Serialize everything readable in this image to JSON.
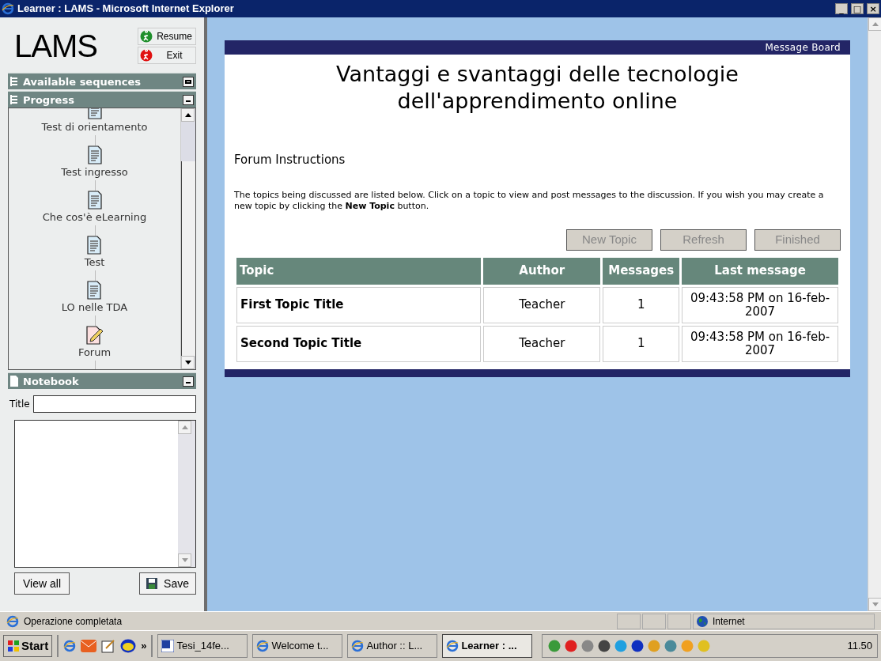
{
  "window": {
    "title": "Learner : LAMS - Microsoft Internet Explorer",
    "controls": [
      "_",
      "□",
      "×"
    ]
  },
  "sidebar": {
    "logo": "LAMS",
    "actions": [
      {
        "label": "Resume",
        "kind": "resume"
      },
      {
        "label": "Exit",
        "kind": "exit"
      }
    ],
    "panels": [
      {
        "title": "Available sequences",
        "expanded": false
      },
      {
        "title": "Progress",
        "expanded": true
      }
    ],
    "progress": [
      {
        "label": "Test di orientamento",
        "kind": "document"
      },
      {
        "label": "Test ingresso",
        "kind": "document"
      },
      {
        "label": "Che cos'è eLearning",
        "kind": "document"
      },
      {
        "label": "Test",
        "kind": "document"
      },
      {
        "label": "LO nelle TDA",
        "kind": "document"
      },
      {
        "label": "Forum",
        "kind": "forum"
      }
    ],
    "notebook": {
      "title": "Notebook",
      "title_label": "Title",
      "buttons": [
        "View all",
        "Save"
      ]
    }
  },
  "board": {
    "header": "Message Board",
    "title": "Vantaggi e svantaggi delle tecnologie dell'apprendimento online",
    "section": "Forum Instructions",
    "instructions": "The topics being discussed are listed below. Click on a topic to view and post messages to the discussion. If you wish you may create a new topic by clicking the **New Topic** button.",
    "buttons": [
      {
        "label": "New Topic",
        "disabled": true
      },
      {
        "label": "Refresh",
        "disabled": true
      },
      {
        "label": "Finished",
        "disabled": true
      }
    ],
    "table": {
      "columns": [
        "Topic",
        "Author",
        "Messages",
        "Last message"
      ],
      "rows": [
        [
          "First Topic Title",
          "Teacher",
          "1",
          "09:43:58 PM on 16-feb-2007"
        ],
        [
          "Second Topic Title",
          "Teacher",
          "1",
          "09:43:58 PM on 16-feb-2007"
        ]
      ]
    }
  },
  "status_bar": {
    "text": "Operazione completata",
    "zone": "Internet"
  },
  "taskbar": {
    "start": "Start",
    "more": "»",
    "tasks": [
      {
        "label": "Tesi_14fe...",
        "kind": "word",
        "selected": false
      },
      {
        "label": "Welcome t...",
        "kind": "ie",
        "selected": false
      },
      {
        "label": "Author :: L...",
        "kind": "ie",
        "selected": false
      },
      {
        "label": "Learner : ...",
        "kind": "ie",
        "selected": true
      }
    ],
    "clock": "11.50"
  }
}
